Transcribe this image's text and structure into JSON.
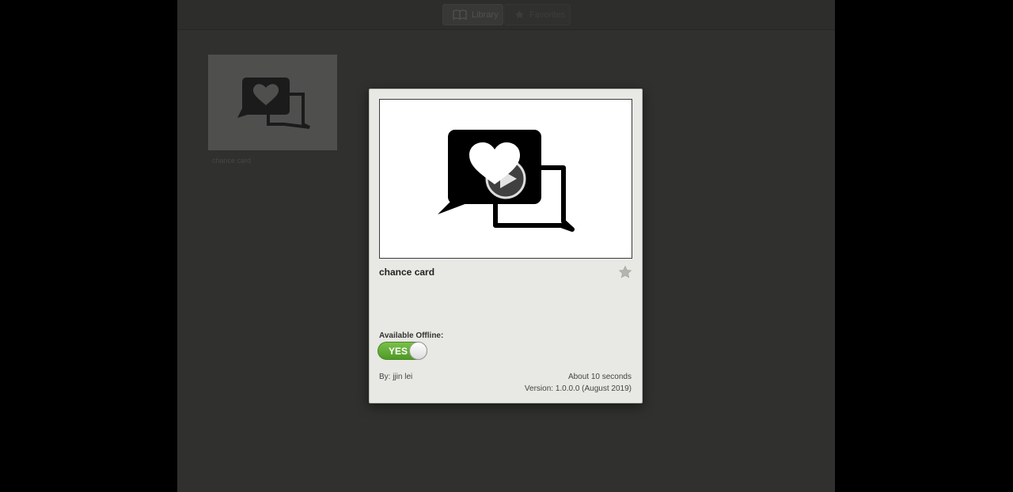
{
  "topbar": {
    "library_label": "Library",
    "favorites_label": "Favorites"
  },
  "library": {
    "items": [
      {
        "label": "chance card"
      }
    ]
  },
  "modal": {
    "title": "chance card",
    "offline_label": "Available Offline:",
    "offline_toggle": "YES",
    "author": "By: jjin lei",
    "duration": "About 10 seconds",
    "version": "Version: 1.0.0.0 (August 2019)"
  },
  "colors": {
    "toggle_on": "#5aa82e",
    "modal_bg": "#e8e8e4",
    "backdrop": "#4a4a48"
  }
}
